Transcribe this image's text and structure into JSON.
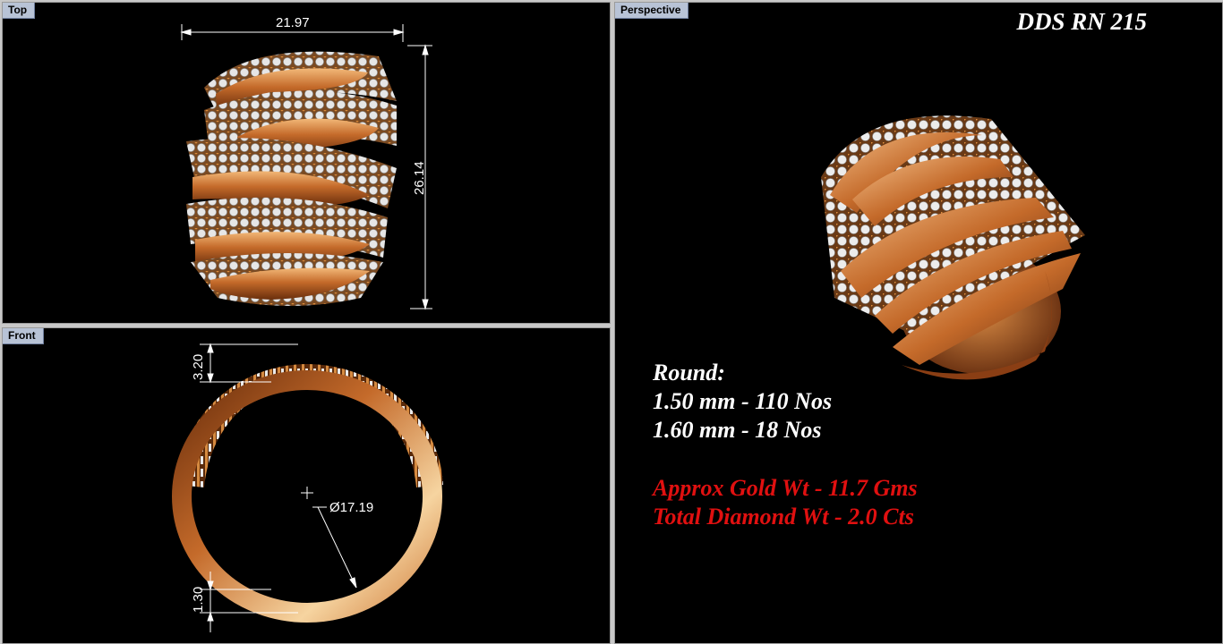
{
  "viewports": {
    "top": {
      "label": "Top",
      "dim_width": "21.97",
      "dim_height": "26.14"
    },
    "front": {
      "label": "Front",
      "dim_top": "3.20",
      "dim_diameter": "Ø17.19",
      "dim_bottom": "1.30"
    },
    "perspective": {
      "label": "Perspective",
      "title": "DDS RN 215"
    }
  },
  "specs": {
    "heading": "Round:",
    "line1": "1.50 mm - 110 Nos",
    "line2": "1.60 mm - 18 Nos",
    "gold": "Approx Gold Wt - 11.7 Gms",
    "diamond": "Total Diamond Wt - 2.0 Cts"
  },
  "colors": {
    "viewport_bg": "#000000",
    "tab_bg": "#b8c3d6",
    "gold": "#c87832",
    "diamond": "#e8e8e8",
    "red_text": "#e01010"
  }
}
